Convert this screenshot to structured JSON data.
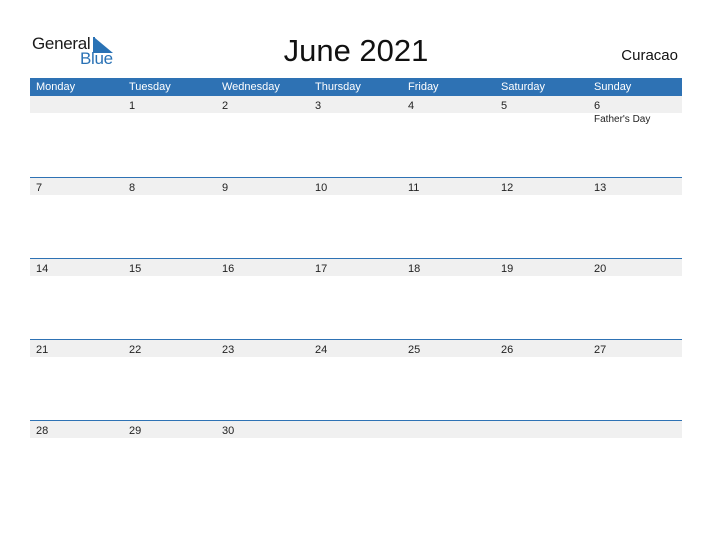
{
  "logo": {
    "word1": "General",
    "word2": "Blue"
  },
  "title": "June 2021",
  "country": "Curacao",
  "colors": {
    "header_bg": "#2e72b4",
    "row_bg": "#f0f0f0",
    "brand_blue": "#2a72b5"
  },
  "weekdays": [
    "Monday",
    "Tuesday",
    "Wednesday",
    "Thursday",
    "Friday",
    "Saturday",
    "Sunday"
  ],
  "weeks": [
    {
      "days": [
        "",
        "1",
        "2",
        "3",
        "4",
        "5",
        "6"
      ],
      "events": [
        "",
        "",
        "",
        "",
        "",
        "",
        "Father's Day"
      ]
    },
    {
      "days": [
        "7",
        "8",
        "9",
        "10",
        "11",
        "12",
        "13"
      ],
      "events": [
        "",
        "",
        "",
        "",
        "",
        "",
        ""
      ]
    },
    {
      "days": [
        "14",
        "15",
        "16",
        "17",
        "18",
        "19",
        "20"
      ],
      "events": [
        "",
        "",
        "",
        "",
        "",
        "",
        ""
      ]
    },
    {
      "days": [
        "21",
        "22",
        "23",
        "24",
        "25",
        "26",
        "27"
      ],
      "events": [
        "",
        "",
        "",
        "",
        "",
        "",
        ""
      ]
    },
    {
      "days": [
        "28",
        "29",
        "30",
        "",
        "",
        "",
        ""
      ],
      "events": [
        "",
        "",
        "",
        "",
        "",
        "",
        ""
      ]
    }
  ]
}
